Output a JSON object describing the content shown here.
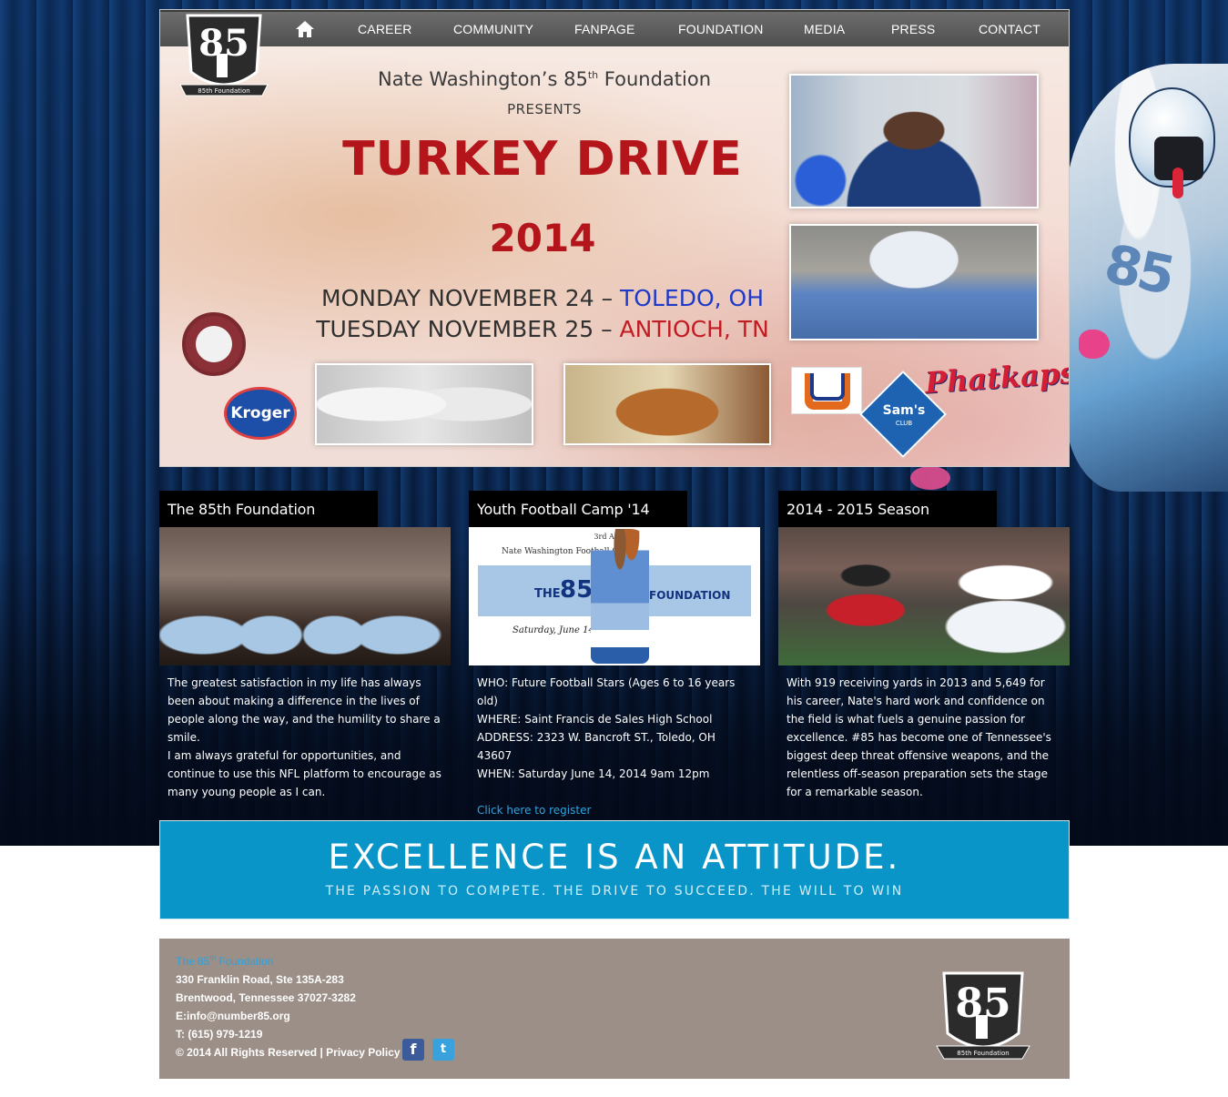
{
  "nav": {
    "home_icon": "home-icon",
    "items": [
      "CAREER",
      "COMMUNITY",
      "FANPAGE",
      "FOUNDATION",
      "MEDIA",
      "PRESS",
      "CONTACT"
    ]
  },
  "logo": {
    "number": "85",
    "caption": "85th Foundation"
  },
  "hero": {
    "title_main": "Nate Washington’s 85",
    "title_sup": "th",
    "title_end": " Foundation",
    "presents": "PRESENTS",
    "headline": "TURKEY DRIVE",
    "year": "2014",
    "date1_prefix": "MONDAY NOVEMBER 24 – ",
    "date1_city": "TOLEDO, OH",
    "date2_prefix": "TUESDAY NOVEMBER 25 – ",
    "date2_city": "ANTIOCH, TN",
    "sponsor_kroger": "Kroger",
    "sponsor_sams": "Sam's",
    "sponsor_sams_sub": "CLUB",
    "sponsor_phatkaps": "Phatkaps"
  },
  "columns": [
    {
      "heading": "The 85th Foundation",
      "paragraphs": [
        "The greatest satisfaction in my life has always been about making a difference in the lives of people along the way, and the humility to share a smile.",
        "I am always grateful for opportunities, and continue to use this NFL platform to encourage as many young people as I can."
      ]
    },
    {
      "heading": "Youth Football Camp '14",
      "camp": {
        "annual": "3rd Annual",
        "camp_name": "Nate Washington Football Camp",
        "the": "THE",
        "num": "85",
        "foundation": "FOUNDATION",
        "date": "Saturday, June 14, 2014"
      },
      "lines": [
        "WHO: Future Football Stars (Ages 6 to 16 years old)",
        "WHERE: Saint Francis de Sales High School",
        "ADDRESS: 2323 W. Bancroft ST., Toledo, OH 43607",
        "WHEN: Saturday June 14, 2014 9am 12pm"
      ],
      "link": "Click here to register"
    },
    {
      "heading": "2014 - 2015 Season",
      "paragraph": "With 919 receiving yards in 2013 and 5,649 for his career, Nate's hard work and confidence on the field is what fuels a genuine passion for excellence. #85 has become one of Tennessee's biggest deep threat offensive weapons, and the relentless off-season preparation sets the stage for a remarkable season."
    }
  ],
  "banner": {
    "headline": "EXCELLENCE IS AN ATTITUDE.",
    "subline": "THE PASSION TO COMPETE. THE DRIVE TO SUCCEED. THE WILL TO WIN"
  },
  "footer": {
    "org_name": "The 85",
    "org_sup": "th",
    "org_end": " Foundation",
    "address1": "330 Franklin Road, Ste 135A-283",
    "address2": "Brentwood, Tennessee 37027-3282",
    "email": "E:info@number85.org",
    "phone": "T: (615) 979-1219",
    "rights": "© 2014 All Rights Reserved ",
    "policy": " | Privacy Policy",
    "facebook_icon": "f",
    "twitter_icon": "t"
  },
  "colors": {
    "nav_bg": "#555555",
    "accent_blue": "#0a95c8",
    "headline_red": "#b3151b",
    "footer_bg": "#9b8f88",
    "link_blue": "#2fa4e1"
  }
}
